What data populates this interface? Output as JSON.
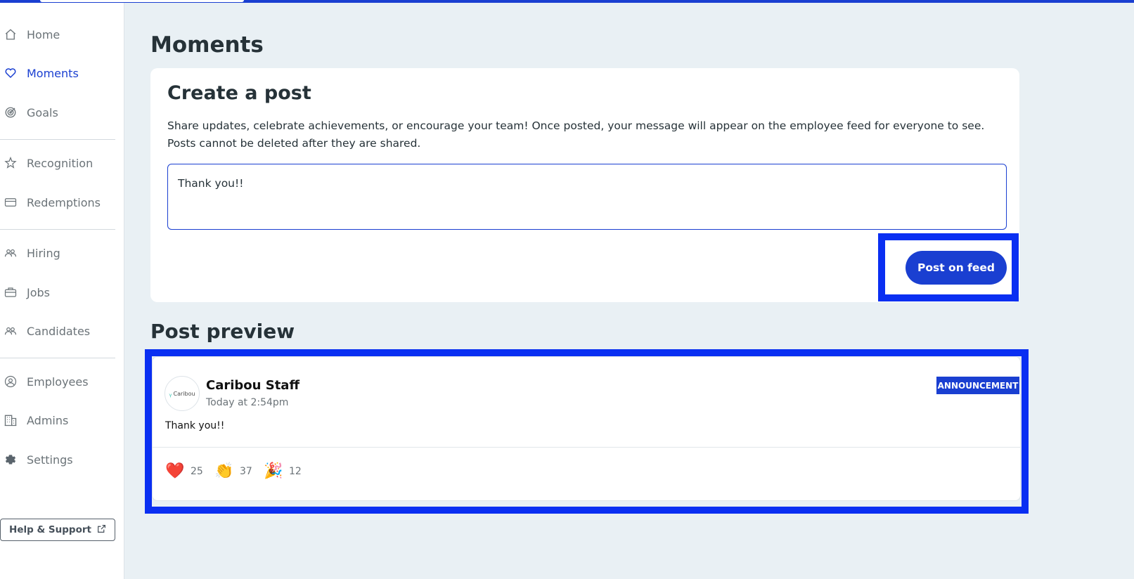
{
  "sidebar": {
    "items": [
      {
        "label": "Home",
        "icon": "home-icon"
      },
      {
        "label": "Moments",
        "icon": "heart-icon",
        "active": true
      },
      {
        "label": "Goals",
        "icon": "target-icon"
      },
      {
        "label": "Recognition",
        "icon": "star-badge-icon"
      },
      {
        "label": "Redemptions",
        "icon": "card-icon"
      },
      {
        "label": "Hiring",
        "icon": "people-icon"
      },
      {
        "label": "Jobs",
        "icon": "briefcase-icon"
      },
      {
        "label": "Candidates",
        "icon": "people-icon"
      },
      {
        "label": "Employees",
        "icon": "user-circle-icon"
      },
      {
        "label": "Admins",
        "icon": "building-icon"
      },
      {
        "label": "Settings",
        "icon": "gear-icon"
      }
    ],
    "help_label": "Help & Support"
  },
  "page": {
    "title": "Moments"
  },
  "create_post": {
    "title": "Create a post",
    "description": "Share updates, celebrate achievements, or encourage your team! Once posted, your message will appear on the employee feed for everyone to see. Posts cannot be deleted after they are shared.",
    "input_value": "Thank you!!",
    "submit_label": "Post on feed"
  },
  "preview": {
    "title": "Post preview",
    "author": "Caribou Staff",
    "avatar_text": "Caribou",
    "timestamp": "Today at 2:54pm",
    "badge": "ANNOUNCEMENT",
    "body": "Thank you!!",
    "reactions": [
      {
        "emoji": "❤️",
        "count": "25",
        "icon": "heart-emoji-icon"
      },
      {
        "emoji": "👏",
        "count": "37",
        "icon": "clap-emoji-icon"
      },
      {
        "emoji": "🎉",
        "count": "12",
        "icon": "party-popper-emoji-icon"
      }
    ]
  },
  "colors": {
    "accent": "#1a3fd1",
    "highlight": "#0a2ff2",
    "background": "#e9f0f4"
  }
}
